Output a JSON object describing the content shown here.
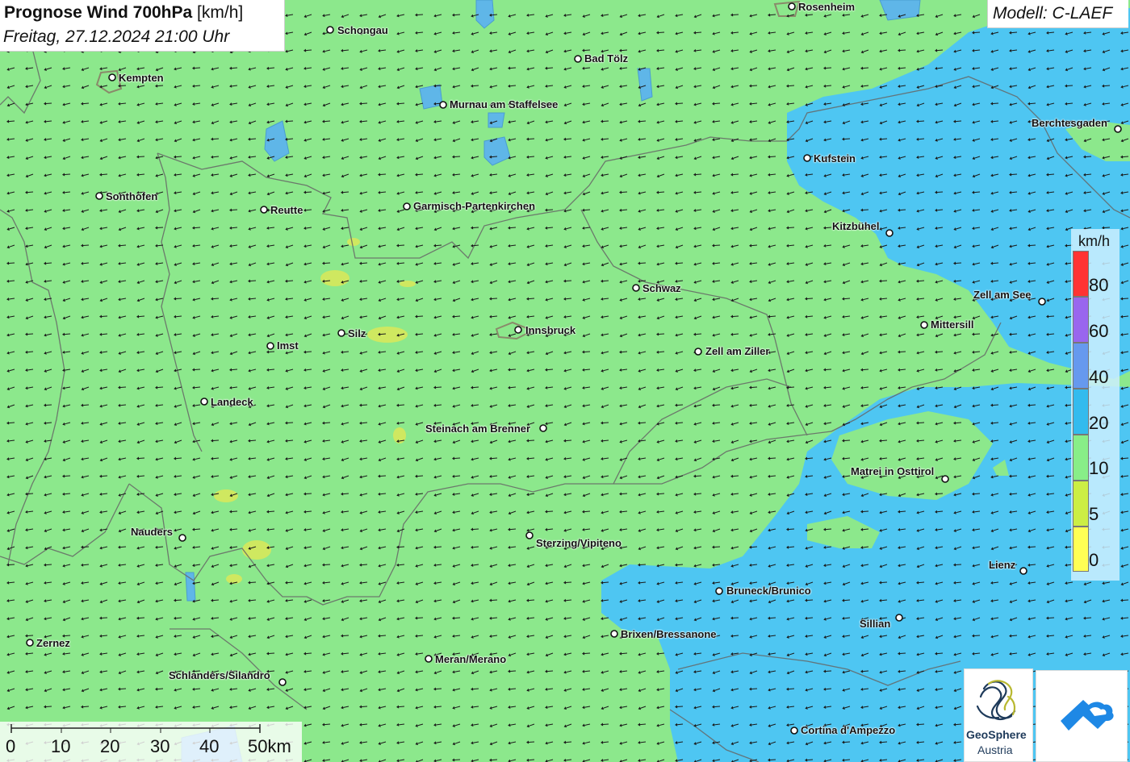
{
  "title": {
    "main": "Prognose Wind 700hPa",
    "unit": "[km/h]",
    "datetime": "Freitag, 27.12.2024 21:00 Uhr"
  },
  "model": "Modell: C-LAEF",
  "cities": [
    {
      "name": "Rosenheim"
    },
    {
      "name": "Schongau"
    },
    {
      "name": "Bad Tölz"
    },
    {
      "name": "Kempten"
    },
    {
      "name": "Murnau am Staffelsee"
    },
    {
      "name": "Berchtesgaden"
    },
    {
      "name": "Kufstein"
    },
    {
      "name": "Sonthofen"
    },
    {
      "name": "Reutte"
    },
    {
      "name": "Garmisch-Partenkirchen"
    },
    {
      "name": "Kitzbühel"
    },
    {
      "name": "Schwaz"
    },
    {
      "name": "Zell am See"
    },
    {
      "name": "Mittersill"
    },
    {
      "name": "Silz"
    },
    {
      "name": "Innsbruck"
    },
    {
      "name": "Imst"
    },
    {
      "name": "Zell am Ziller"
    },
    {
      "name": "Landeck"
    },
    {
      "name": "Steinach am Brenner"
    },
    {
      "name": "Matrei in Osttirol"
    },
    {
      "name": "Nauders"
    },
    {
      "name": "Sterzing/Vipiteno"
    },
    {
      "name": "Lienz"
    },
    {
      "name": "Bruneck/Brunico"
    },
    {
      "name": "Sillian"
    },
    {
      "name": "Brixen/Bressanone"
    },
    {
      "name": "Zernez"
    },
    {
      "name": "Meran/Merano"
    },
    {
      "name": "Schlanders/Silandro"
    },
    {
      "name": "Cortina d'Ampezzo"
    }
  ],
  "legend": {
    "title": "km/h",
    "entries": [
      {
        "label": "80",
        "color": "#ff3333"
      },
      {
        "label": "60",
        "color": "#9966ee"
      },
      {
        "label": "40",
        "color": "#6699ee"
      },
      {
        "label": "20",
        "color": "#33bbee"
      },
      {
        "label": "10",
        "color": "#88ee88"
      },
      {
        "label": "5",
        "color": "#ccee44"
      },
      {
        "label": "0",
        "color": "#ffff55"
      }
    ]
  },
  "scale": {
    "labels": [
      "0",
      "10",
      "20",
      "30",
      "40",
      "50km"
    ]
  },
  "logos": {
    "geosphere_name": "GeoSphere",
    "geosphere_country": "Austria"
  },
  "colors": {
    "low_wind": "#8ce88c",
    "mid_wind": "#4ec6f2",
    "yellow_patch": "#cfe860"
  }
}
